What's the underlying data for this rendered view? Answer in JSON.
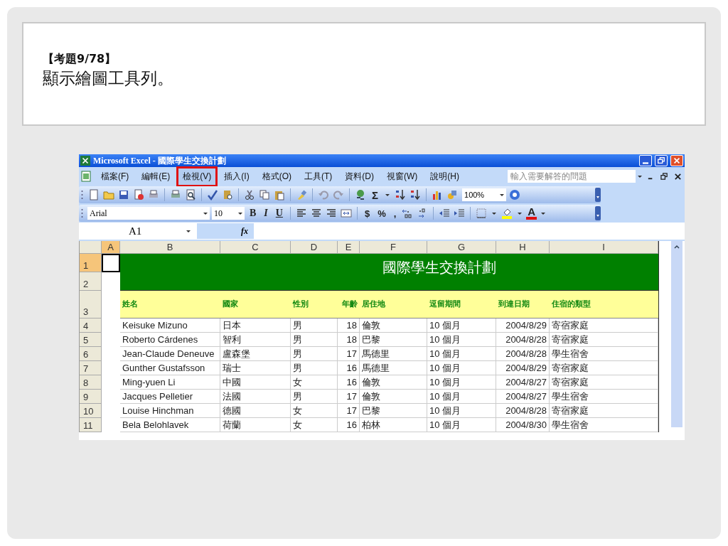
{
  "slide": {
    "question_number": "【考題9/78】",
    "question": "顯示繪圖工具列。"
  },
  "excel": {
    "title": "Microsoft Excel - 國際學生交換計劃",
    "menu": [
      {
        "label": "檔案(F)",
        "highlighted": false
      },
      {
        "label": "編輯(E)",
        "highlighted": false
      },
      {
        "label": "檢視(V)",
        "highlighted": true
      },
      {
        "label": "插入(I)",
        "highlighted": false
      },
      {
        "label": "格式(O)",
        "highlighted": false
      },
      {
        "label": "工具(T)",
        "highlighted": false
      },
      {
        "label": "資料(D)",
        "highlighted": false
      },
      {
        "label": "視窗(W)",
        "highlighted": false
      },
      {
        "label": "說明(H)",
        "highlighted": false
      }
    ],
    "help_placeholder": "輸入需要解答的問題",
    "sum_label": "Σ",
    "zoom": "100%",
    "font": "Arial",
    "font_size": "10",
    "style_buttons": [
      "B",
      "I",
      "U"
    ],
    "number_buttons": [
      "$",
      "%",
      ","
    ],
    "font_color_label": "A",
    "name_box": "A1",
    "function_label": "fx",
    "columns": [
      {
        "label": "A",
        "selected": true
      },
      {
        "label": "B",
        "selected": false
      },
      {
        "label": "C",
        "selected": false
      },
      {
        "label": "D",
        "selected": false
      },
      {
        "label": "E",
        "selected": false
      },
      {
        "label": "F",
        "selected": false
      },
      {
        "label": "G",
        "selected": false
      },
      {
        "label": "H",
        "selected": false
      },
      {
        "label": "I",
        "selected": false
      }
    ],
    "row_numbers": [
      {
        "label": "1",
        "selected": true
      },
      {
        "label": "2",
        "selected": false
      },
      {
        "label": "3",
        "selected": false
      },
      {
        "label": "4",
        "selected": false
      },
      {
        "label": "5",
        "selected": false
      },
      {
        "label": "6",
        "selected": false
      },
      {
        "label": "7",
        "selected": false
      },
      {
        "label": "8",
        "selected": false
      },
      {
        "label": "9",
        "selected": false
      },
      {
        "label": "10",
        "selected": false
      },
      {
        "label": "11",
        "selected": false
      }
    ],
    "sheet_title": "國際學生交換計劃",
    "headers": [
      "姓名",
      "國家",
      "性別",
      "年齡",
      "居住地",
      "逗留期間",
      "到達日期",
      "住宿的類型"
    ],
    "rows": [
      [
        "",
        "Keisuke Mizuno",
        "日本",
        "男",
        "18",
        "倫敦",
        "10 個月",
        "2004/8/29",
        "寄宿家庭"
      ],
      [
        "",
        "Roberto Cárdenes",
        "智利",
        "男",
        "18",
        "巴黎",
        "10 個月",
        "2004/8/28",
        "寄宿家庭"
      ],
      [
        "",
        "Jean-Claude Deneuve",
        "盧森堡",
        "男",
        "17",
        "馬德里",
        "10 個月",
        "2004/8/28",
        "學生宿舍"
      ],
      [
        "",
        "Gunther Gustafsson",
        "瑞士",
        "男",
        "16",
        "馬德里",
        "10 個月",
        "2004/8/29",
        "寄宿家庭"
      ],
      [
        "",
        "Ming-yuen Li",
        "中國",
        "女",
        "16",
        "倫敦",
        "10 個月",
        "2004/8/27",
        "寄宿家庭"
      ],
      [
        "",
        "Jacques Pelletier",
        "法國",
        "男",
        "17",
        "倫敦",
        "10 個月",
        "2004/8/27",
        "學生宿舍"
      ],
      [
        "",
        "Louise Hinchman",
        "德國",
        "女",
        "17",
        "巴黎",
        "10 個月",
        "2004/8/28",
        "寄宿家庭"
      ],
      [
        "",
        "Bela Belohlavek",
        "荷蘭",
        "女",
        "16",
        "柏林",
        "10 個月",
        "2004/8/30",
        "學生宿舍"
      ]
    ]
  }
}
